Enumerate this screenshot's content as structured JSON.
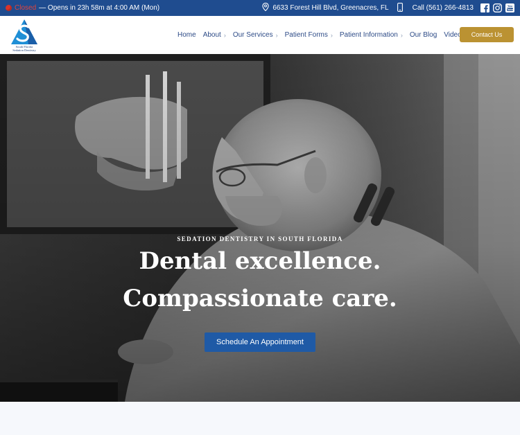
{
  "topbar": {
    "status_word": "Closed",
    "hours_text": "— Opens in 23h 58m at 4:00 AM (Mon)",
    "address": "6633 Forest Hill Blvd, Greenacres, FL",
    "phone": "Call (561) 266-4813",
    "social_icons": [
      "facebook-icon",
      "instagram-icon",
      "youtube-icon"
    ]
  },
  "header": {
    "logo_caption_line1": "South Florida",
    "logo_caption_line2": "Sedation Dentistry",
    "nav": [
      {
        "label": "Home",
        "has_submenu": false
      },
      {
        "label": "About",
        "has_submenu": true
      },
      {
        "label": "Our Services",
        "has_submenu": true
      },
      {
        "label": "Patient Forms",
        "has_submenu": true
      },
      {
        "label": "Patient Information",
        "has_submenu": true
      },
      {
        "label": "Our Blog",
        "has_submenu": false
      },
      {
        "label": "Videos",
        "has_submenu": false
      }
    ],
    "contact_label": "Contact Us"
  },
  "hero": {
    "eyebrow": "SEDATION DENTISTRY IN SOUTH FLORIDA",
    "headline_line1": "Dental excellence.",
    "headline_line2": "Compassionate care.",
    "cta_label": "Schedule An Appointment"
  },
  "colors": {
    "topbar_bg": "#1f4c8f",
    "nav_text": "#2c4a86",
    "contact_bg": "#bb9232",
    "cta_bg": "#1f5aa6",
    "status_closed": "#e3443c"
  }
}
